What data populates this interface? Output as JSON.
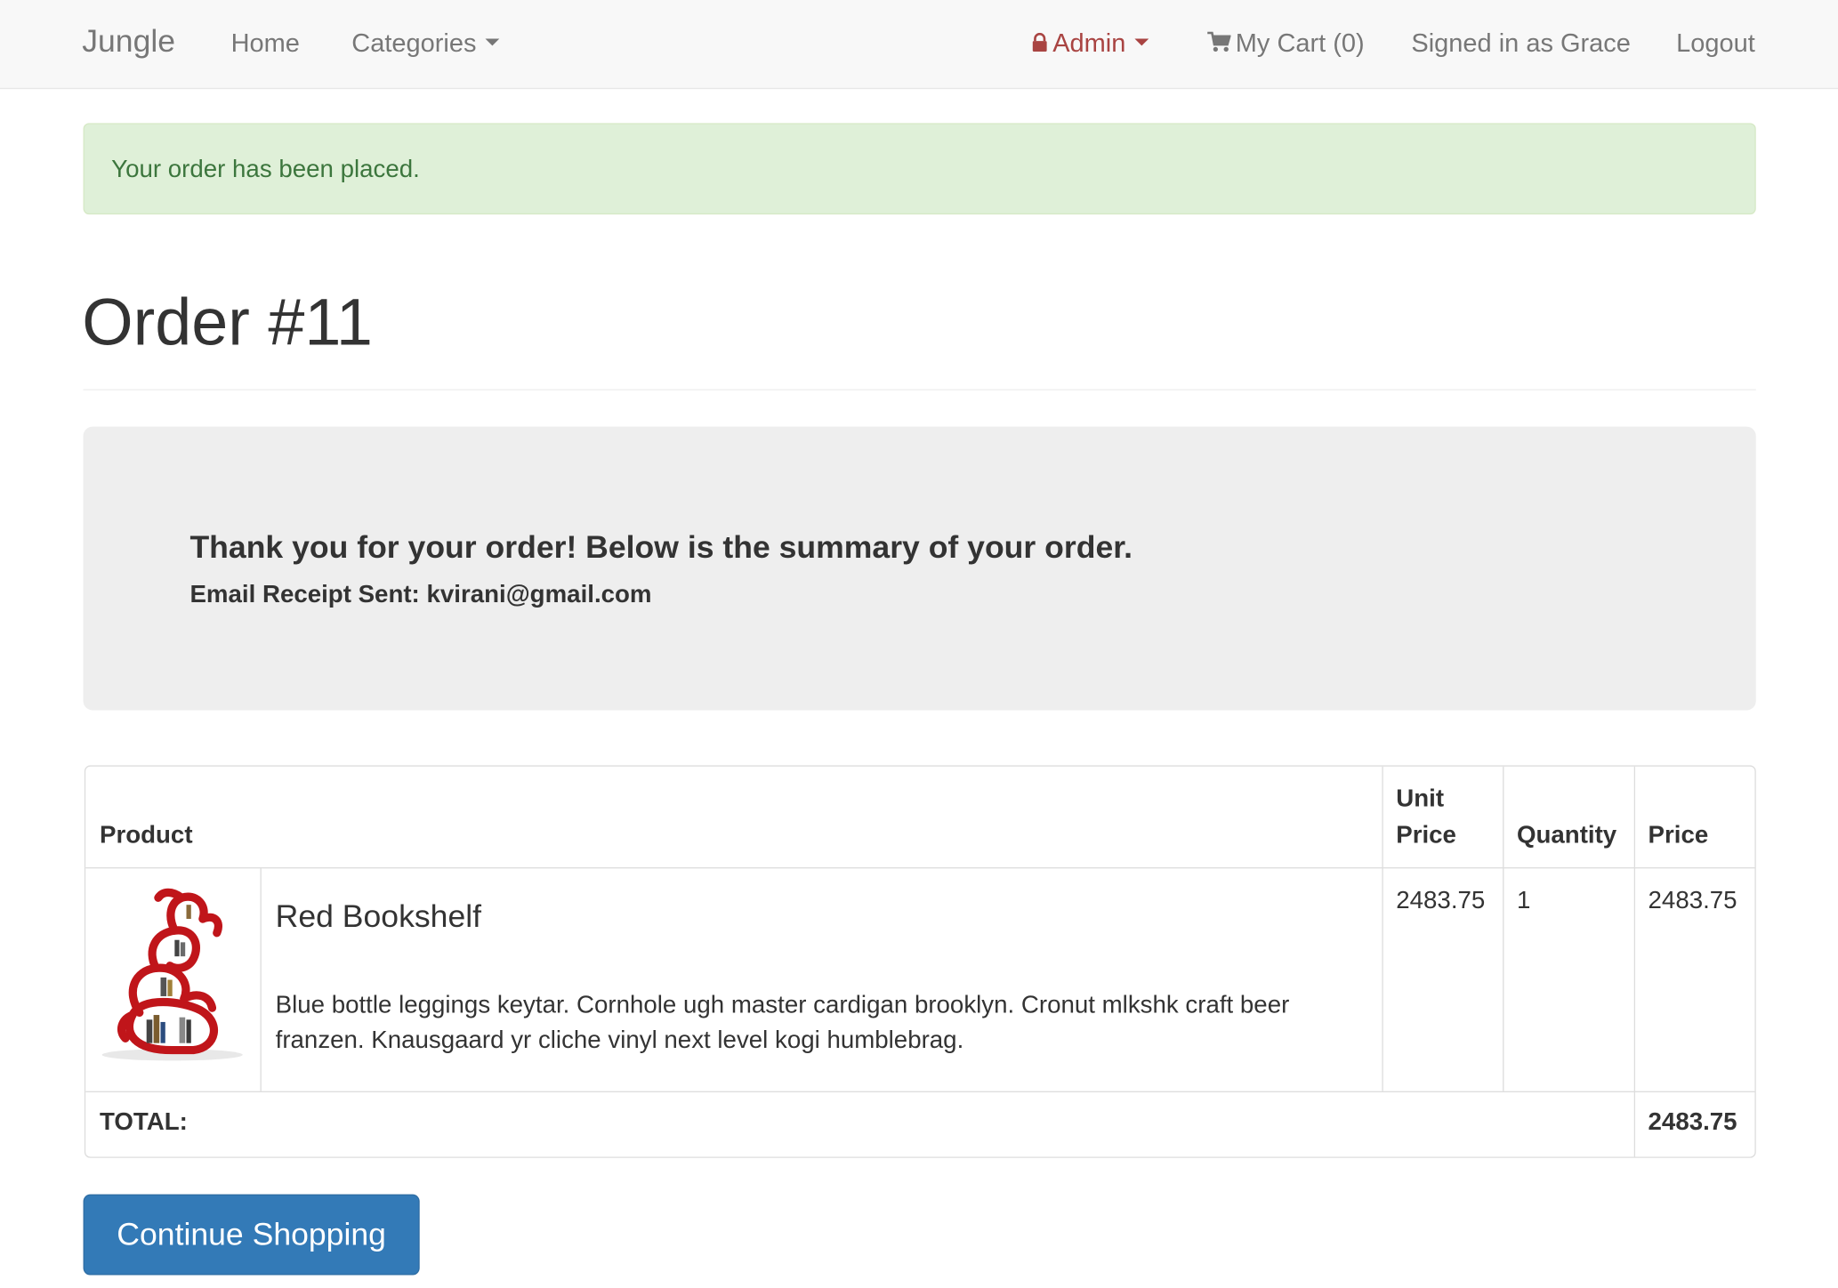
{
  "navbar": {
    "brand": "Jungle",
    "home": "Home",
    "categories": "Categories",
    "admin": "Admin",
    "cart": "My Cart (0)",
    "signed_in": "Signed in as Grace",
    "logout": "Logout"
  },
  "alert": {
    "message": "Your order has been placed."
  },
  "page": {
    "title": "Order #11"
  },
  "summary": {
    "heading": "Thank you for your order! Below is the summary of your order.",
    "receipt_label": "Email Receipt Sent:",
    "receipt_email": "kvirani@gmail.com"
  },
  "table": {
    "headers": {
      "product": "Product",
      "unit_price_1": "Unit",
      "unit_price_2": "Price",
      "quantity": "Quantity",
      "price": "Price"
    },
    "rows": [
      {
        "name": "Red Bookshelf",
        "description": "Blue bottle leggings keytar. Cornhole ugh master cardigan brooklyn. Cronut mlkshk craft beer franzen. Knausgaard yr cliche vinyl next level kogi humblebrag.",
        "unit_price": "2483.75",
        "quantity": "1",
        "price": "2483.75"
      }
    ],
    "total_label": "TOTAL:",
    "total_value": "2483.75"
  },
  "actions": {
    "continue_label": "Continue Shopping"
  },
  "colors": {
    "alert_bg": "#dff0d8",
    "alert_text": "#3c763d",
    "admin": "#a94442",
    "button": "#337ab7"
  }
}
